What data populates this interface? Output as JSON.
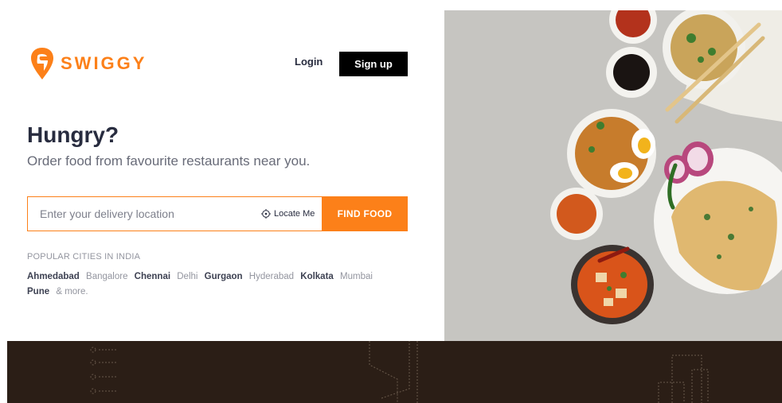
{
  "brand": {
    "name": "SWIGGY",
    "accent": "#fc8019"
  },
  "nav": {
    "login": "Login",
    "signup": "Sign up"
  },
  "hero": {
    "title": "Hungry?",
    "subtitle": "Order food from favourite restaurants near you."
  },
  "search": {
    "placeholder": "Enter your delivery location",
    "locate_label": "Locate Me",
    "find_button": "FIND FOOD"
  },
  "popular": {
    "title": "POPULAR CITIES IN INDIA",
    "cities": [
      {
        "name": "Ahmedabad",
        "style": "dark"
      },
      {
        "name": "Bangalore",
        "style": "light"
      },
      {
        "name": "Chennai",
        "style": "dark"
      },
      {
        "name": "Delhi",
        "style": "light"
      },
      {
        "name": "Gurgaon",
        "style": "dark"
      },
      {
        "name": "Hyderabad",
        "style": "light"
      },
      {
        "name": "Kolkata",
        "style": "dark"
      },
      {
        "name": "Mumbai",
        "style": "light"
      },
      {
        "name": "Pune",
        "style": "dark"
      }
    ],
    "more": "& more."
  },
  "colors": {
    "heading": "#282c3f",
    "muted": "#686b78",
    "footer_bg": "#2b1e16"
  }
}
